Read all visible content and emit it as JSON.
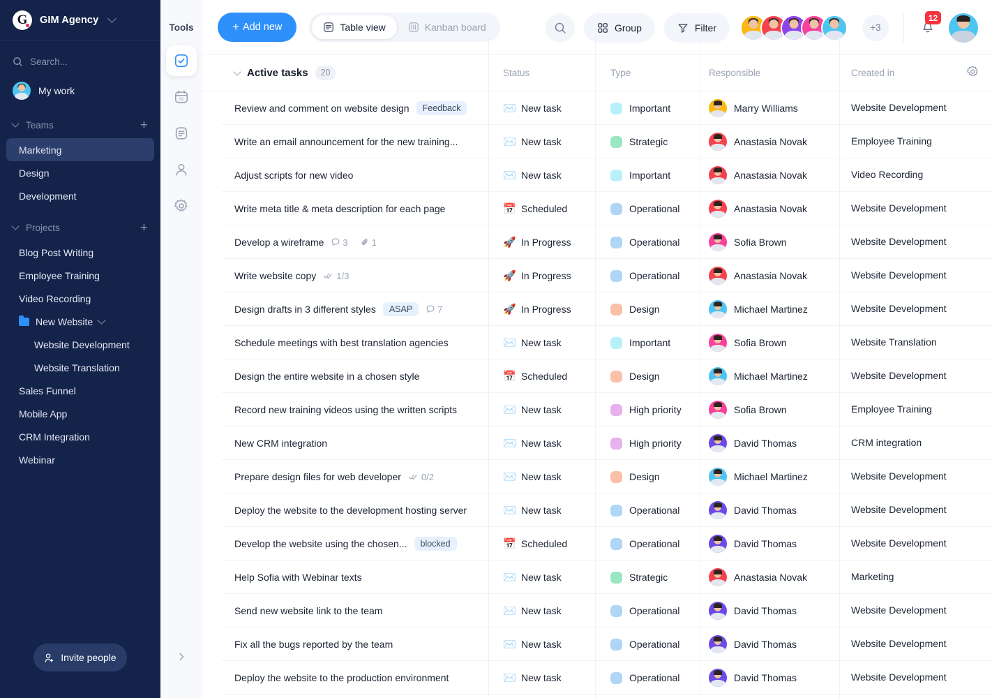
{
  "sidebar": {
    "brand": {
      "logo_letter": "G",
      "name": "GIM Agency",
      "chevron_icon": "chevron-down-icon"
    },
    "search_placeholder": "Search...",
    "my_work": "My work",
    "teams_header": "Teams",
    "teams": [
      "Marketing",
      "Design",
      "Development"
    ],
    "active_team": "Marketing",
    "projects_header": "Projects",
    "projects": [
      {
        "label": "Blog Post Writing",
        "type": "item"
      },
      {
        "label": "Employee Training",
        "type": "item"
      },
      {
        "label": "Video Recording",
        "type": "item"
      },
      {
        "label": "New Website",
        "type": "folder"
      },
      {
        "label": "Website Development",
        "type": "sub"
      },
      {
        "label": "Website Translation",
        "type": "sub"
      },
      {
        "label": "Sales Funnel",
        "type": "item"
      },
      {
        "label": "Mobile App",
        "type": "item"
      },
      {
        "label": "CRM Integration",
        "type": "item"
      },
      {
        "label": "Webinar",
        "type": "item"
      }
    ],
    "invite_label": "Invite people",
    "add_icon": "plus-icon"
  },
  "rail": {
    "title": "Tools",
    "items": [
      {
        "icon": "tasks-check-icon",
        "active": true
      },
      {
        "icon": "calendar-icon",
        "active": false
      },
      {
        "icon": "document-icon",
        "active": false
      },
      {
        "icon": "user-icon",
        "active": false
      },
      {
        "icon": "gear-icon",
        "active": false
      }
    ],
    "collapse_icon": "chevron-right-icon"
  },
  "topbar": {
    "add_new": "Add new",
    "views": [
      {
        "label": "Table view",
        "icon": "table-icon",
        "active": true
      },
      {
        "label": "Kanban board",
        "icon": "kanban-icon",
        "active": false
      }
    ],
    "search_icon": "search-icon",
    "group_label": "Group",
    "group_icon": "grid-icon",
    "filter_label": "Filter",
    "filter_icon": "funnel-icon",
    "avatar_overflow": "+3",
    "notification_count": "12",
    "bell_icon": "bell-icon",
    "avatar_colors": [
      "#fcb813",
      "#f5424f",
      "#8b45e8",
      "#f7419c",
      "#4ec5f1"
    ]
  },
  "table": {
    "group_label": "Active tasks",
    "group_count": "20",
    "settings_icon": "gear-icon",
    "columns": [
      "Status",
      "Type",
      "Responsible",
      "Created in"
    ],
    "type_colors": {
      "Important": "#b8f0fa",
      "Strategic": "#9ae6c0",
      "Operational": "#afd6f7",
      "Design": "#fbc0a8",
      "High priority": "#e8b0ed"
    },
    "status_icons": {
      "New task": "✉️",
      "Scheduled": "📅",
      "In Progress": "🚀"
    },
    "avatar_colors": {
      "Marry Williams": "#fcb813",
      "Anastasia Novak": "#f5424f",
      "Sofia Brown": "#f7419c",
      "Michael Martinez": "#4ec5f1",
      "David Thomas": "#6b4ae8"
    },
    "rows": [
      {
        "name": "Review and comment on website design",
        "tag": "Feedback",
        "status": "New task",
        "type": "Important",
        "responsible": "Marry Williams",
        "project": "Website Development"
      },
      {
        "name": "Write an email announcement for the new training...",
        "status": "New task",
        "type": "Strategic",
        "responsible": "Anastasia Novak",
        "project": "Employee Training"
      },
      {
        "name": "Adjust scripts for new video",
        "status": "New task",
        "type": "Important",
        "responsible": "Anastasia Novak",
        "project": "Video Recording"
      },
      {
        "name": "Write meta title & meta description for each page",
        "status": "Scheduled",
        "type": "Operational",
        "responsible": "Anastasia Novak",
        "project": "Website Development"
      },
      {
        "name": "Develop a wireframe",
        "comments": "3",
        "attachments": "1",
        "status": "In Progress",
        "type": "Operational",
        "responsible": "Sofia Brown",
        "project": "Website Development"
      },
      {
        "name": "Write website copy",
        "subtasks": "1/3",
        "status": "In Progress",
        "type": "Operational",
        "responsible": "Anastasia Novak",
        "project": "Website Development"
      },
      {
        "name": "Design drafts in 3 different styles",
        "tag": "ASAP",
        "comments": "7",
        "status": "In Progress",
        "type": "Design",
        "responsible": "Michael Martinez",
        "project": "Website Development"
      },
      {
        "name": "Schedule meetings with best translation agencies",
        "status": "New task",
        "type": "Important",
        "responsible": "Sofia Brown",
        "project": "Website Translation"
      },
      {
        "name": "Design the entire website in a chosen style",
        "status": "Scheduled",
        "type": "Design",
        "responsible": "Michael Martinez",
        "project": "Website Development"
      },
      {
        "name": "Record new training videos using the written scripts",
        "status": "New task",
        "type": "High priority",
        "responsible": "Sofia Brown",
        "project": "Employee Training"
      },
      {
        "name": "New CRM integration",
        "status": "New task",
        "type": "High priority",
        "responsible": "David Thomas",
        "project": "CRM integration"
      },
      {
        "name": "Prepare design files for web developer",
        "subtasks": "0/2",
        "status": "New task",
        "type": "Design",
        "responsible": "Michael Martinez",
        "project": "Website Development"
      },
      {
        "name": "Deploy the website to the development hosting server",
        "status": "New task",
        "type": "Operational",
        "responsible": "David Thomas",
        "project": "Website Development"
      },
      {
        "name": "Develop the website using the chosen...",
        "tag": "blocked",
        "status": "Scheduled",
        "type": "Operational",
        "responsible": "David Thomas",
        "project": "Website Development"
      },
      {
        "name": "Help Sofia with Webinar texts",
        "status": "New task",
        "type": "Strategic",
        "responsible": "Anastasia Novak",
        "project": "Marketing"
      },
      {
        "name": "Send new website link to the team",
        "status": "New task",
        "type": "Operational",
        "responsible": "David Thomas",
        "project": "Website Development"
      },
      {
        "name": "Fix all the bugs reported by the team",
        "status": "New task",
        "type": "Operational",
        "responsible": "David Thomas",
        "project": "Website Development"
      },
      {
        "name": "Deploy the website to the production environment",
        "status": "New task",
        "type": "Operational",
        "responsible": "David Thomas",
        "project": "Website Development"
      }
    ]
  }
}
